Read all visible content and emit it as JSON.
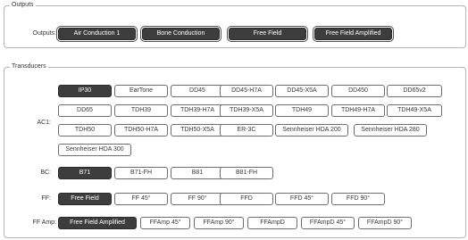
{
  "outputs": {
    "legend": "Outputs",
    "row_label": "Outputs:",
    "buttons": [
      {
        "label": "Air Conduction 1",
        "selected": true
      },
      {
        "label": "Bone Conduction",
        "selected": true
      },
      {
        "label": "Free Field",
        "selected": true
      },
      {
        "label": "Free Field Amplified",
        "selected": true
      }
    ]
  },
  "transducers": {
    "legend": "Transducers",
    "ac1": {
      "label": "AC1:",
      "buttons": [
        {
          "label": "IP30",
          "selected": true
        },
        {
          "label": "EarTone",
          "selected": false
        },
        {
          "label": "DD45",
          "selected": false
        },
        {
          "label": "DD45-H7A",
          "selected": false
        },
        {
          "label": "DD45-X5A",
          "selected": false
        },
        {
          "label": "DD450",
          "selected": false
        },
        {
          "label": "DD65v2",
          "selected": false
        },
        {
          "label": "DD65",
          "selected": false
        },
        {
          "label": "TDH39",
          "selected": false
        },
        {
          "label": "TDH39-H7A",
          "selected": false
        },
        {
          "label": "TDH39-X5A",
          "selected": false
        },
        {
          "label": "TDH49",
          "selected": false
        },
        {
          "label": "TDH49-H7A",
          "selected": false
        },
        {
          "label": "TDH49-X5A",
          "selected": false
        },
        {
          "label": "TDH50",
          "selected": false
        },
        {
          "label": "TDH50-H7A",
          "selected": false
        },
        {
          "label": "TDH50-X5A",
          "selected": false
        },
        {
          "label": "ER-3C",
          "selected": false
        },
        {
          "label": "Sennheiser HDA 200",
          "selected": false
        },
        {
          "label": "Sennheiser HDA 280",
          "selected": false
        },
        {
          "label": "Sennheiser HDA 300",
          "selected": false
        }
      ]
    },
    "bc": {
      "label": "BC:",
      "buttons": [
        {
          "label": "B71",
          "selected": true
        },
        {
          "label": "B71-FH",
          "selected": false
        },
        {
          "label": "B81",
          "selected": false
        },
        {
          "label": "B81-FH",
          "selected": false
        }
      ]
    },
    "ff": {
      "label": "FF:",
      "buttons": [
        {
          "label": "Free Field",
          "selected": true
        },
        {
          "label": "FF 45°",
          "selected": false
        },
        {
          "label": "FF 90°",
          "selected": false
        },
        {
          "label": "FFD",
          "selected": false
        },
        {
          "label": "FFD 45°",
          "selected": false
        },
        {
          "label": "FFD 90°",
          "selected": false
        }
      ]
    },
    "ffamp": {
      "label": "FF Amp:",
      "buttons": [
        {
          "label": "Free Field Amplified",
          "selected": true
        },
        {
          "label": "FFAmp 45°",
          "selected": false
        },
        {
          "label": "FFAmp 90°",
          "selected": false
        },
        {
          "label": "FFAmpD",
          "selected": false
        },
        {
          "label": "FFAmpD 45°",
          "selected": false
        },
        {
          "label": "FFAmpD 90°",
          "selected": false
        }
      ]
    }
  }
}
